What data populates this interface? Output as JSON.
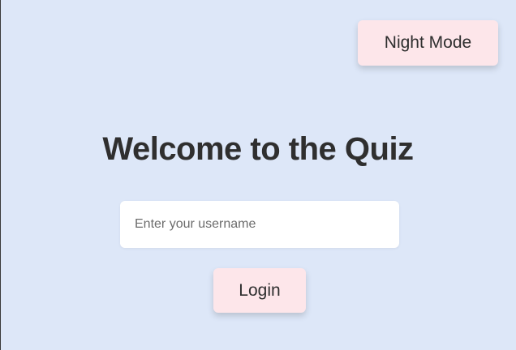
{
  "header": {
    "night_mode_label": "Night Mode"
  },
  "main": {
    "title": "Welcome to the Quiz",
    "username_placeholder": "Enter your username",
    "username_value": "",
    "login_label": "Login"
  },
  "colors": {
    "background": "#dde7f8",
    "button_background": "#fde6ea",
    "text": "#2f2f2f",
    "input_background": "#ffffff"
  }
}
